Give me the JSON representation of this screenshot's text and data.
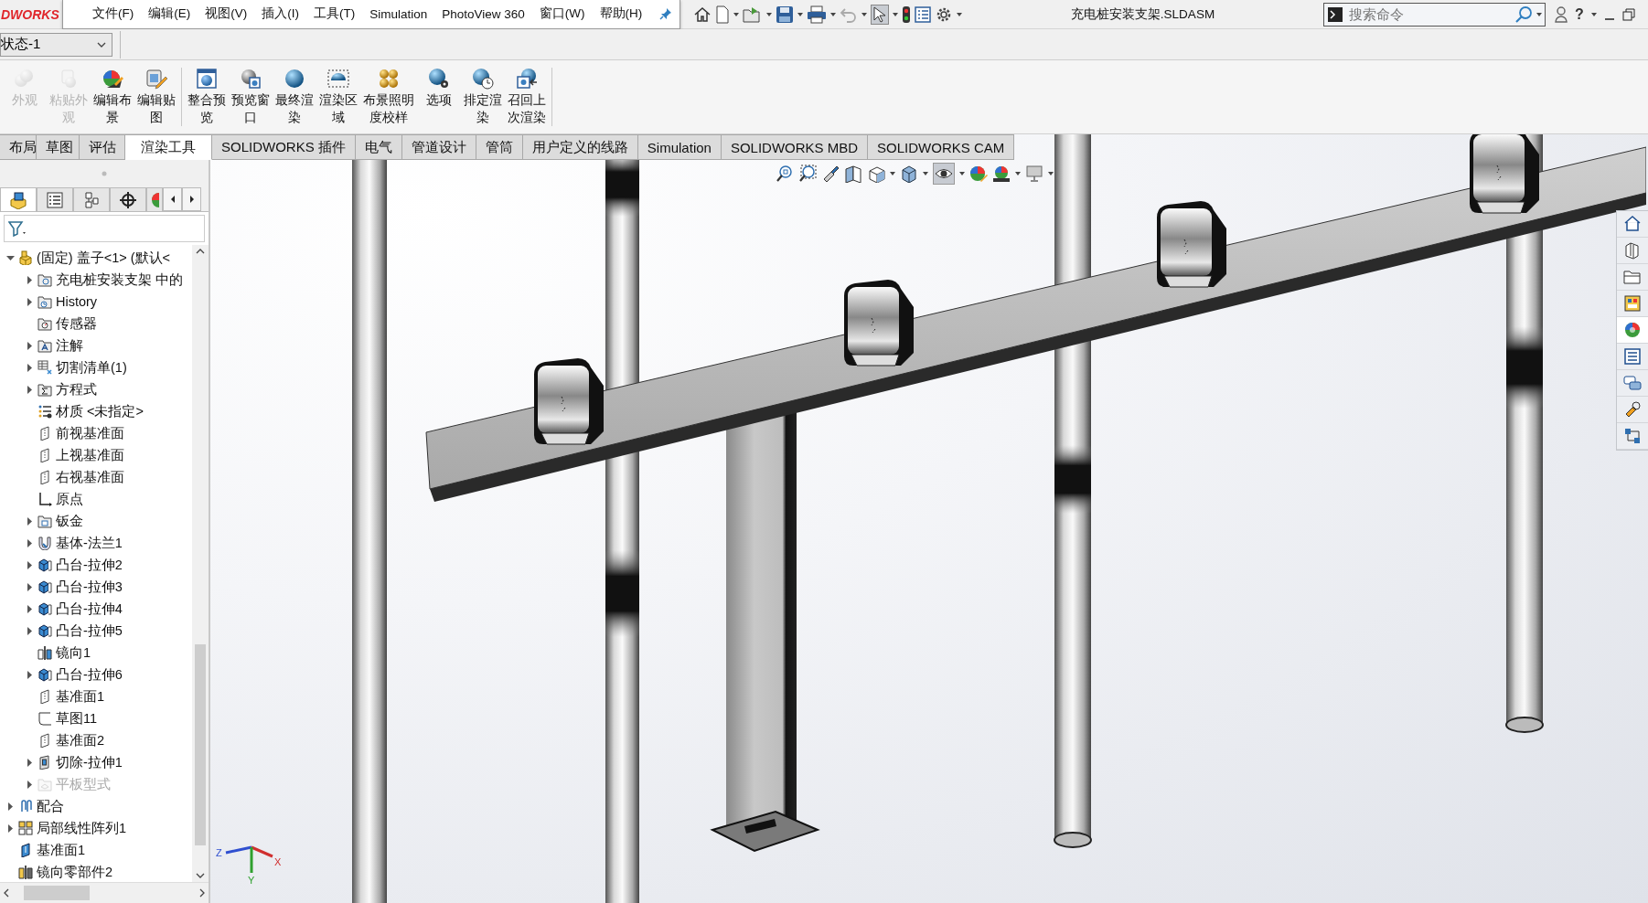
{
  "app": {
    "logo_text": "DWORKS",
    "help_glyph": "?"
  },
  "menu": [
    "文件(F)",
    "编辑(E)",
    "视图(V)",
    "插入(I)",
    "工具(T)",
    "Simulation",
    "PhotoView 360",
    "窗口(W)",
    "帮助(H)"
  ],
  "document_title": "充电桩安装支架.SLDASM",
  "search": {
    "placeholder": "搜索命令"
  },
  "configuration": {
    "value": "状态-1"
  },
  "ribbon": {
    "groups": [
      [
        {
          "label": "外观",
          "disabled": true
        },
        {
          "label": "粘贴外观",
          "disabled": true
        },
        {
          "label": "编辑布景",
          "disabled": false
        },
        {
          "label": "编辑贴图",
          "disabled": false
        }
      ],
      [
        {
          "label": "整合预览",
          "disabled": false
        },
        {
          "label": "预览窗口",
          "disabled": false
        },
        {
          "label": "最终渲染",
          "disabled": false
        },
        {
          "label": "渲染区域",
          "disabled": false
        },
        {
          "label": "布景照明度校样",
          "disabled": false
        },
        {
          "label": "选项",
          "disabled": false
        },
        {
          "label": "排定渲染",
          "disabled": false
        },
        {
          "label": "召回上次渲染",
          "disabled": false
        }
      ]
    ]
  },
  "command_tabs": [
    {
      "label": "布局",
      "selected": false
    },
    {
      "label": "草图",
      "selected": false
    },
    {
      "label": "评估",
      "selected": false
    },
    {
      "label": "渲染工具",
      "selected": true
    },
    {
      "label": "SOLIDWORKS 插件",
      "selected": false
    },
    {
      "label": "电气",
      "selected": false
    },
    {
      "label": "管道设计",
      "selected": false
    },
    {
      "label": "管筒",
      "selected": false
    },
    {
      "label": "用户定义的线路",
      "selected": false
    },
    {
      "label": "Simulation",
      "selected": false
    },
    {
      "label": "SOLIDWORKS MBD",
      "selected": false
    },
    {
      "label": "SOLIDWORKS CAM",
      "selected": false
    }
  ],
  "feature_tree": [
    {
      "label": "(固定) 盖子<1> (默认<",
      "kind": "part",
      "expanded": true,
      "disabled": false,
      "children": [
        {
          "label": "充电桩安装支架 中的",
          "kind": "folder-link",
          "expanded": false,
          "disabled": false
        },
        {
          "label": "History",
          "kind": "folder-history",
          "expanded": false,
          "disabled": false
        },
        {
          "label": "传感器",
          "kind": "folder-sensor",
          "disabled": false
        },
        {
          "label": "注解",
          "kind": "annotation",
          "expanded": false,
          "disabled": false
        },
        {
          "label": "切割清单(1)",
          "kind": "cutlist",
          "expanded": false,
          "disabled": false
        },
        {
          "label": "方程式",
          "kind": "equation",
          "expanded": false,
          "disabled": false
        },
        {
          "label": "材质 <未指定>",
          "kind": "material",
          "disabled": false
        },
        {
          "label": "前视基准面",
          "kind": "plane",
          "disabled": false
        },
        {
          "label": "上视基准面",
          "kind": "plane",
          "disabled": false
        },
        {
          "label": "右视基准面",
          "kind": "plane",
          "disabled": false
        },
        {
          "label": "原点",
          "kind": "origin",
          "disabled": false
        },
        {
          "label": "钣金",
          "kind": "sheetmetal",
          "expanded": false,
          "disabled": false
        },
        {
          "label": "基体-法兰1",
          "kind": "flange",
          "expanded": false,
          "disabled": false
        },
        {
          "label": "凸台-拉伸2",
          "kind": "extrude",
          "expanded": false,
          "disabled": false
        },
        {
          "label": "凸台-拉伸3",
          "kind": "extrude",
          "expanded": false,
          "disabled": false
        },
        {
          "label": "凸台-拉伸4",
          "kind": "extrude",
          "expanded": false,
          "disabled": false
        },
        {
          "label": "凸台-拉伸5",
          "kind": "extrude",
          "expanded": false,
          "disabled": false
        },
        {
          "label": "镜向1",
          "kind": "mirror",
          "disabled": false
        },
        {
          "label": "凸台-拉伸6",
          "kind": "extrude",
          "expanded": false,
          "disabled": false
        },
        {
          "label": "基准面1",
          "kind": "plane",
          "disabled": false
        },
        {
          "label": "草图11",
          "kind": "sketch",
          "disabled": false
        },
        {
          "label": "基准面2",
          "kind": "plane",
          "disabled": false
        },
        {
          "label": "切除-拉伸1",
          "kind": "cut",
          "expanded": false,
          "disabled": false
        },
        {
          "label": "平板型式",
          "kind": "flat",
          "expanded": false,
          "disabled": true
        }
      ]
    },
    {
      "label": "配合",
      "kind": "mates",
      "expanded": false,
      "disabled": false
    },
    {
      "label": "局部线性阵列1",
      "kind": "pattern",
      "expanded": false,
      "disabled": false
    },
    {
      "label": "基准面1",
      "kind": "plane-solid",
      "disabled": false
    },
    {
      "label": "镜向零部件2",
      "kind": "mirror-part",
      "disabled": false
    }
  ],
  "panel_tabs": [
    {
      "selected": true
    },
    {
      "selected": false
    },
    {
      "selected": false
    },
    {
      "selected": false
    },
    {
      "selected": false
    }
  ],
  "task_pane_tabs": [
    {
      "selected": false
    },
    {
      "selected": false
    },
    {
      "selected": false
    },
    {
      "selected": false
    },
    {
      "selected": true
    },
    {
      "selected": false
    },
    {
      "selected": false
    },
    {
      "selected": false
    },
    {
      "selected": false
    }
  ],
  "triad": {
    "x": "X",
    "y": "Y",
    "z": "Z"
  }
}
